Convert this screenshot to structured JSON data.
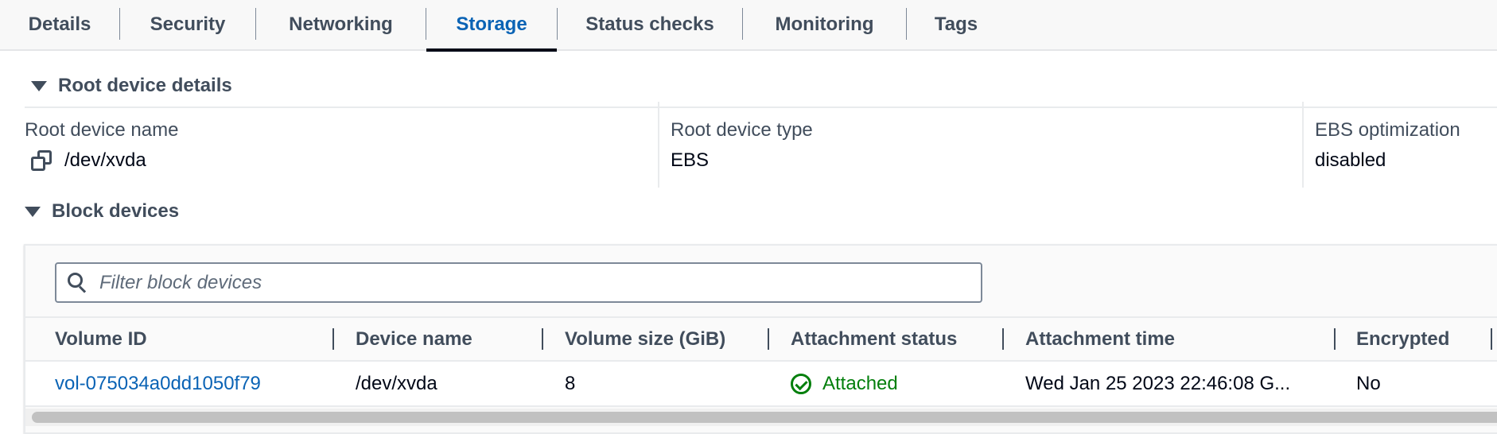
{
  "tabs": [
    {
      "label": "Details",
      "active": false
    },
    {
      "label": "Security",
      "active": false
    },
    {
      "label": "Networking",
      "active": false
    },
    {
      "label": "Storage",
      "active": true
    },
    {
      "label": "Status checks",
      "active": false
    },
    {
      "label": "Monitoring",
      "active": false
    },
    {
      "label": "Tags",
      "active": false
    }
  ],
  "root_device": {
    "title": "Root device details",
    "expanded": true,
    "fields": [
      {
        "label": "Root device name",
        "value": "/dev/xvda",
        "icon": "copy-icon"
      },
      {
        "label": "Root device type",
        "value": "EBS"
      },
      {
        "label": "EBS optimization",
        "value": "disabled"
      }
    ]
  },
  "block_devices": {
    "title": "Block devices",
    "expanded": true,
    "search": {
      "placeholder": "Filter block devices",
      "value": "",
      "icon": "search-icon"
    },
    "columns": [
      "Volume ID",
      "Device name",
      "Volume size (GiB)",
      "Attachment status",
      "Attachment time",
      "Encrypted"
    ],
    "rows": [
      {
        "volume_id": "vol-075034a0dd1050f79",
        "device_name": "/dev/xvda",
        "volume_size": "8",
        "attachment_status": "Attached",
        "attachment_time": "Wed Jan 25 2023 22:46:08 G...",
        "encrypted": "No"
      }
    ]
  },
  "colors": {
    "accent": "#0a63b5",
    "success": "#037f0c",
    "heading": "#414d5c"
  }
}
